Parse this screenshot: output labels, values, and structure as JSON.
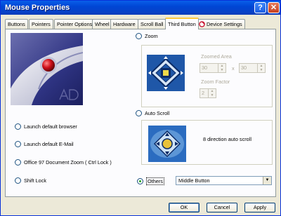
{
  "window": {
    "title": "Mouse Properties"
  },
  "titlebar_buttons": {
    "help": "?",
    "close": "✕"
  },
  "tabs": [
    {
      "label": "Buttons"
    },
    {
      "label": "Pointers"
    },
    {
      "label": "Pointer Options"
    },
    {
      "label": "Wheel"
    },
    {
      "label": "Hardware"
    },
    {
      "label": "Scroll Ball"
    },
    {
      "label": "Third Button"
    },
    {
      "label": "Device Settings"
    }
  ],
  "active_tab": "Third Button",
  "options_left": [
    {
      "label": "Launch default browser"
    },
    {
      "label": "Launch default E-Mail"
    },
    {
      "label": "Office 97 Document Zoom ( Ctrl Lock )"
    },
    {
      "label": "Shift Lock"
    }
  ],
  "zoom": {
    "label": "Zoom",
    "zoomed_area_label": "Zoomed Area",
    "width_value": "30",
    "separator": "x",
    "height_value": "30",
    "zoom_factor_label": "Zoom Factor",
    "factor_value": "2"
  },
  "auto_scroll": {
    "label": "Auto Scroll",
    "description": "8 direction auto scroll"
  },
  "others": {
    "label": "Others",
    "selected": "Middle Button"
  },
  "buttons": {
    "ok": "OK",
    "cancel": "Cancel",
    "apply": "Apply"
  },
  "colors": {
    "title_bar": "#0a5fe9",
    "dialog_bg": "#ece9d8",
    "active_tab_accent": "#ffc83c"
  }
}
